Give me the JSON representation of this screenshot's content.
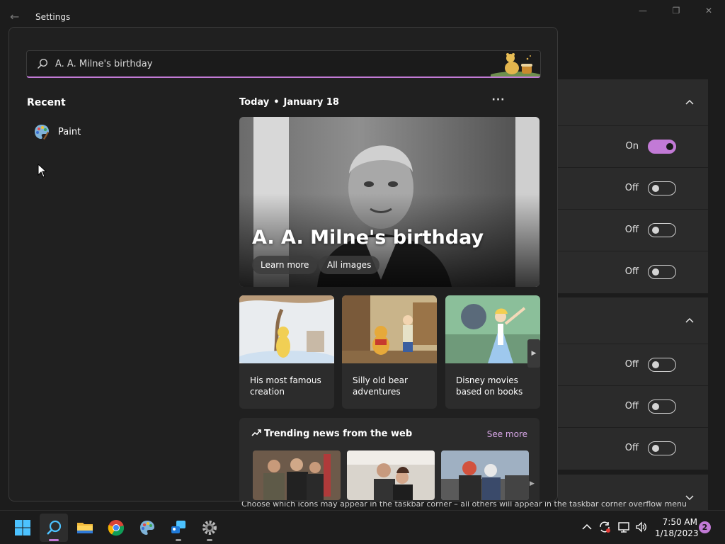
{
  "window": {
    "title": "Settings"
  },
  "settings_rows": {
    "group1": [
      {
        "state": "On",
        "on": true
      },
      {
        "state": "Off",
        "on": false
      },
      {
        "state": "Off",
        "on": false
      },
      {
        "state": "Off",
        "on": false
      }
    ],
    "group2": [
      {
        "state": "Off",
        "on": false
      },
      {
        "state": "Off",
        "on": false
      },
      {
        "state": "Off",
        "on": false
      }
    ]
  },
  "tray_caption": "Choose which icons may appear in the taskbar corner – all others will appear in the taskbar corner overflow menu",
  "search": {
    "value": "A. A. Milne's birthday",
    "icon": "search-icon"
  },
  "recent": {
    "heading": "Recent",
    "items": [
      {
        "label": "Paint",
        "icon": "paint-icon"
      }
    ]
  },
  "today": {
    "label": "Today",
    "date": "January 18",
    "more": "···",
    "hero": {
      "title": "A. A. Milne's birthday",
      "learn_more": "Learn more",
      "all_images": "All images"
    },
    "cards": [
      {
        "label": "His most famous creation"
      },
      {
        "label": "Silly old bear adventures"
      },
      {
        "label": "Disney movies based on books"
      }
    ]
  },
  "trending": {
    "heading": "Trending news from the web",
    "see_more": "See more"
  },
  "taskbar": {
    "time": "7:50 AM",
    "date": "1/18/2023",
    "notifications": "2"
  },
  "colors": {
    "accent": "#c27ad6",
    "background": "#1c1c1c",
    "panel": "#202020"
  }
}
